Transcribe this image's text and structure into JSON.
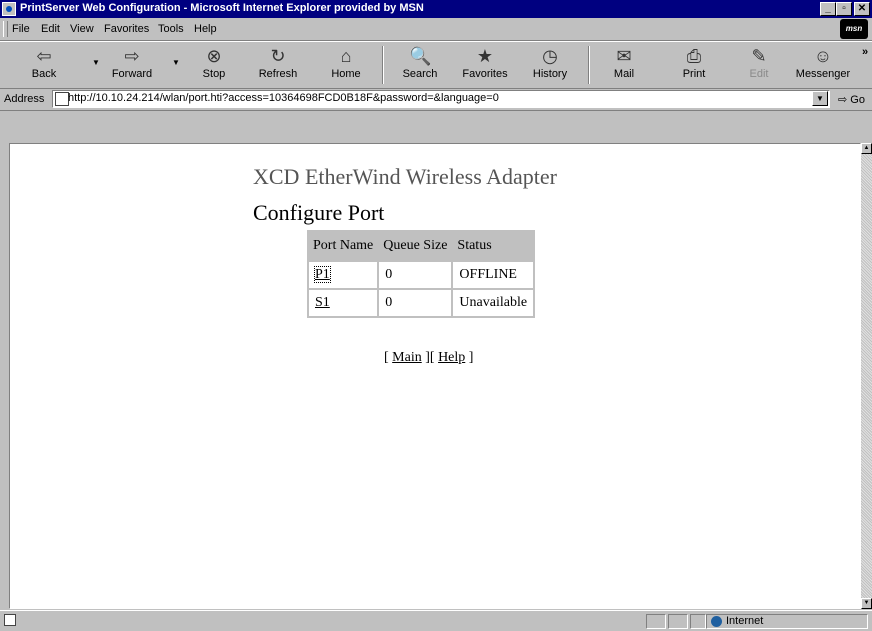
{
  "window": {
    "title": "PrintServer Web Configuration - Microsoft Internet Explorer provided by MSN",
    "controls": {
      "minimize": "_",
      "maximize": "▫",
      "close": "✕"
    }
  },
  "menu": {
    "items": [
      "File",
      "Edit",
      "View",
      "Favorites",
      "Tools",
      "Help"
    ],
    "brand_badge": "msn"
  },
  "toolbar": {
    "back": {
      "label": "Back",
      "icon": "⇦"
    },
    "forward": {
      "label": "Forward",
      "icon": "⇨"
    },
    "stop": {
      "label": "Stop",
      "icon": "⊗"
    },
    "refresh": {
      "label": "Refresh",
      "icon": "↻"
    },
    "home": {
      "label": "Home",
      "icon": "⌂"
    },
    "search": {
      "label": "Search",
      "icon": "🔍"
    },
    "favorites": {
      "label": "Favorites",
      "icon": "★"
    },
    "history": {
      "label": "History",
      "icon": "◷"
    },
    "mail": {
      "label": "Mail",
      "icon": "✉"
    },
    "print": {
      "label": "Print",
      "icon": "⎙"
    },
    "edit": {
      "label": "Edit",
      "icon": "✎"
    },
    "messenger": {
      "label": "Messenger",
      "icon": "☺"
    },
    "overflow": "»"
  },
  "address": {
    "label": "Address",
    "url": "http://10.10.24.214/wlan/port.hti?access=10364698FCD0B18F&password=&language=0",
    "go_label": "Go"
  },
  "page": {
    "product_title": "XCD EtherWind Wireless Adapter",
    "heading": "Configure Port",
    "table": {
      "headers": [
        "Port Name",
        "Queue Size",
        "Status"
      ],
      "rows": [
        {
          "port": "P1",
          "queue": "0",
          "status": "OFFLINE"
        },
        {
          "port": "S1",
          "queue": "0",
          "status": "Unavailable"
        }
      ]
    },
    "links": {
      "open1": "[ ",
      "main": "Main",
      "mid": " ][ ",
      "help": "Help",
      "close": " ]"
    }
  },
  "status": {
    "zone": "Internet"
  }
}
